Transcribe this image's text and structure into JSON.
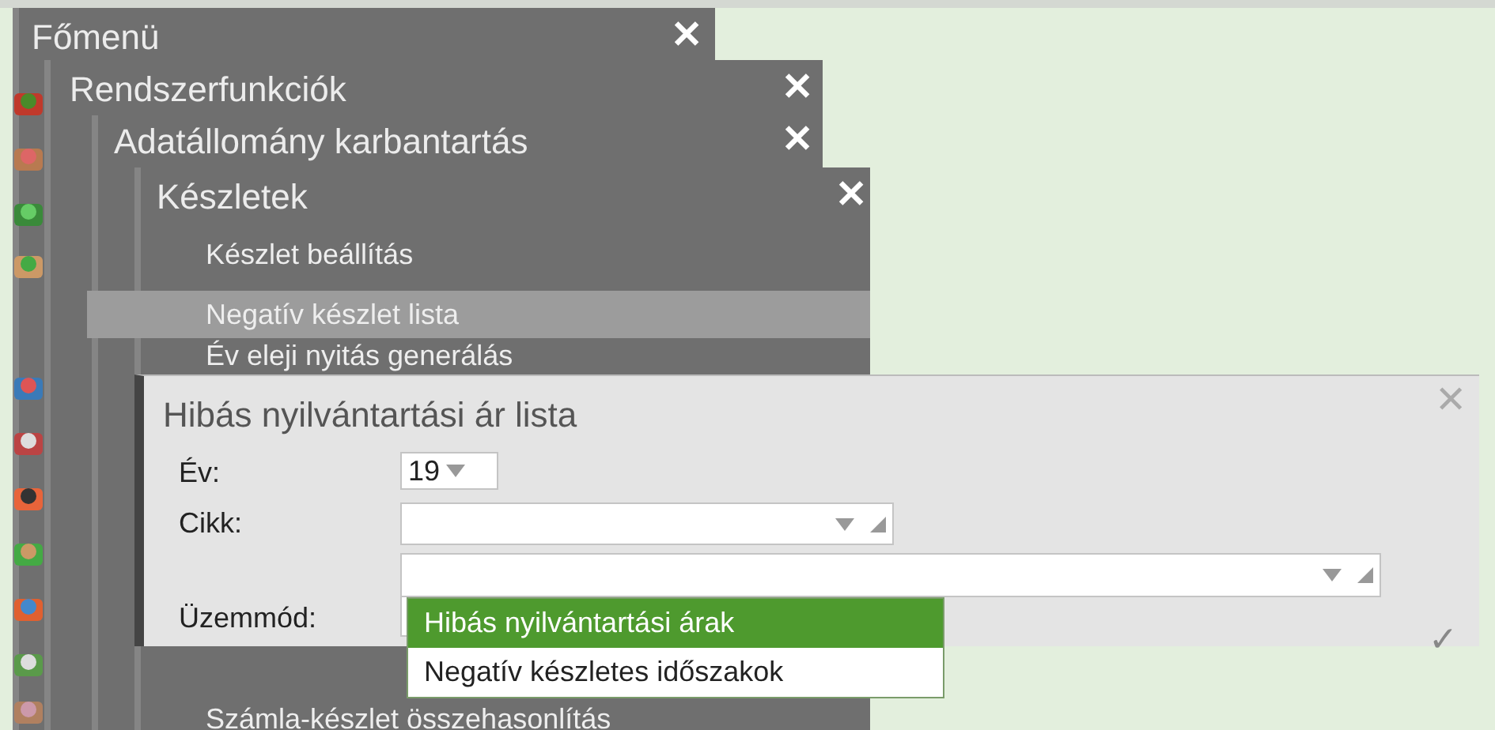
{
  "menus": [
    {
      "title": "Főmenü"
    },
    {
      "title": "Rendszerfunkciók"
    },
    {
      "title": "Adatállomány karbantartás"
    },
    {
      "title": "Készletek"
    }
  ],
  "menu_items": [
    {
      "label": "Készlet beállítás",
      "selected": false
    },
    {
      "label": "Negatív készlet lista",
      "selected": true
    },
    {
      "label": "Év eleji nyitás generálás",
      "selected": false
    },
    {
      "label": "Számla-készlet összehasonlítás",
      "selected": false
    }
  ],
  "close_symbol": "✕",
  "dialog": {
    "title": "Hibás nyilvántartási ár lista",
    "close_symbol": "✕",
    "fields": [
      {
        "kind": "select",
        "label": "Év:",
        "value": "19"
      },
      {
        "kind": "combo",
        "label": "Cikk:"
      },
      {
        "kind": "combo_wide"
      },
      {
        "kind": "dropdown",
        "label": "Üzemmód:",
        "options": [
          {
            "label": "Hibás nyilvántartási árak",
            "selected": true
          },
          {
            "label": "Negatív készletes időszakok",
            "selected": false
          }
        ]
      }
    ],
    "ok_symbol": "✓"
  }
}
